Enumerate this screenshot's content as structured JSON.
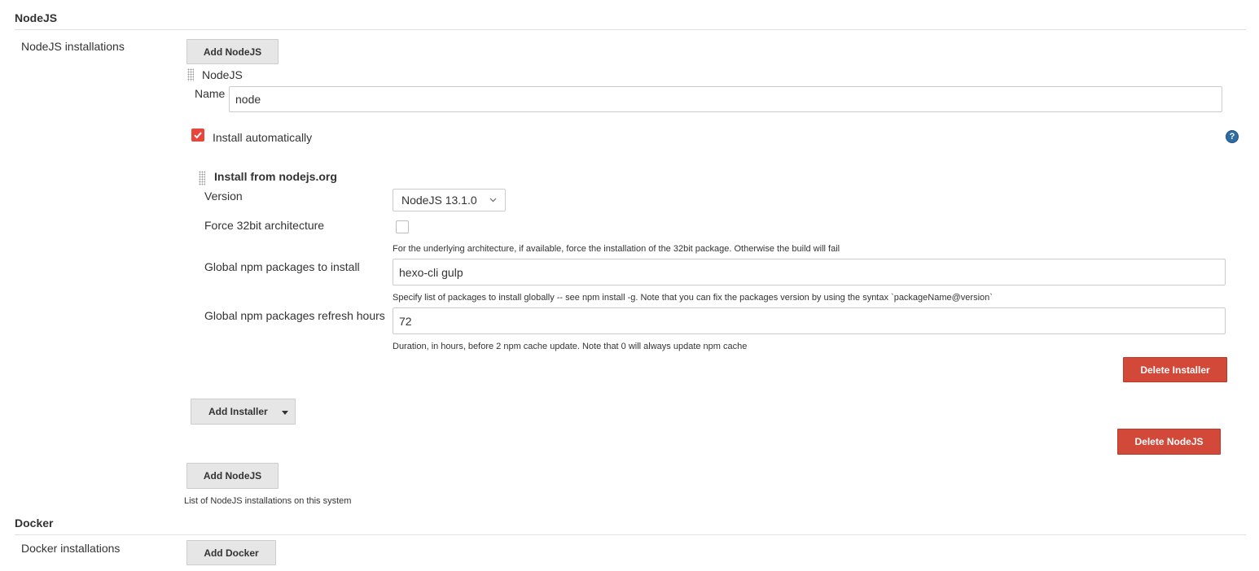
{
  "nodejs_section": {
    "title": "NodeJS",
    "installations_label": "NodeJS installations",
    "add_button_label": "Add NodeJS",
    "installation": {
      "header": "NodeJS",
      "name_label": "Name",
      "name_value": "node",
      "install_auto_label": "Install automatically",
      "install_auto_checked": true,
      "help_icon": "question-mark-icon",
      "installer": {
        "header": "Install from nodejs.org",
        "version_label": "Version",
        "version_value": "NodeJS 13.1.0",
        "force32_label": "Force 32bit architecture",
        "force32_checked": false,
        "force32_help": "For the underlying architecture, if available, force the installation of the 32bit package. Otherwise the build will fail",
        "global_pkgs_label": "Global npm packages to install",
        "global_pkgs_value": "hexo-cli gulp",
        "global_pkgs_help": "Specify list of packages to install globally -- see npm install -g. Note that you can fix the packages version by using the syntax `packageName@version`",
        "refresh_label": "Global npm packages refresh hours",
        "refresh_value": "72",
        "refresh_help": "Duration, in hours, before 2 npm cache update. Note that 0 will always update npm cache",
        "delete_label": "Delete Installer"
      },
      "add_installer_label": "Add Installer",
      "delete_label": "Delete NodeJS"
    },
    "add_button_bottom_label": "Add NodeJS",
    "list_help": "List of NodeJS installations on this system"
  },
  "docker_section": {
    "title": "Docker",
    "installations_label": "Docker installations",
    "add_button_label": "Add Docker"
  },
  "colors": {
    "danger": "#d24939",
    "checkbox": "#e8453c",
    "help_icon": "#2e6da4"
  }
}
